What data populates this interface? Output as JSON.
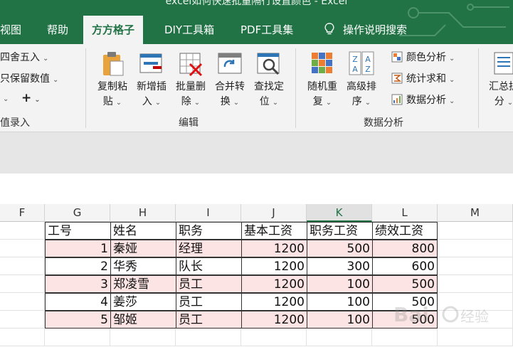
{
  "window": {
    "title_partial": "excel如何快速批量隔行设置颜色 - Excel"
  },
  "tabs": [
    {
      "label": "视图"
    },
    {
      "label": "帮助"
    },
    {
      "label": "方方格子",
      "active": true
    },
    {
      "label": "DIY工具箱"
    },
    {
      "label": "PDF工具集"
    },
    {
      "label": "操作说明搜索"
    }
  ],
  "ribbon": {
    "left_group": {
      "round": "四舍五入",
      "keep_values": "只保留数值",
      "plus": "+",
      "group_label": "值录入"
    },
    "edit_group": {
      "buttons": [
        {
          "line1": "复制粘",
          "line2": "贴"
        },
        {
          "line1": "新增插",
          "line2": "入"
        },
        {
          "line1": "批量删",
          "line2": "除"
        },
        {
          "line1": "合并转",
          "line2": "换"
        },
        {
          "line1": "查找定",
          "line2": "位"
        }
      ],
      "group_label": "编辑"
    },
    "analysis_group": {
      "buttons": [
        {
          "line1": "随机重",
          "line2": "复"
        },
        {
          "line1": "高级排",
          "line2": "序"
        }
      ],
      "small_items": [
        "颜色分析",
        "统计求和",
        "数据分析"
      ],
      "group_label": "数据分析"
    },
    "summary_group": {
      "line1": "汇总拆",
      "line2": "分"
    },
    "sort_glyph": {
      "top": "Z",
      "mid": "A",
      "right_top": "A",
      "right_bottom": "Z"
    }
  },
  "grid": {
    "columns": [
      "F",
      "G",
      "H",
      "I",
      "J",
      "K",
      "L",
      "M"
    ],
    "selected_column": "K",
    "header": [
      "工号",
      "姓名",
      "职务",
      "基本工资",
      "职务工资",
      "绩效工资"
    ],
    "rows": [
      [
        "1",
        "秦娅",
        "经理",
        "1200",
        "500",
        "800"
      ],
      [
        "2",
        "华秀",
        "队长",
        "1200",
        "300",
        "600"
      ],
      [
        "3",
        "郑凌雪",
        "员工",
        "1200",
        "100",
        "500"
      ],
      [
        "4",
        "姜莎",
        "员工",
        "1200",
        "100",
        "500"
      ],
      [
        "5",
        "邹姬",
        "员工",
        "1200",
        "100",
        "500"
      ]
    ],
    "highlight_color": "#fce4e4"
  },
  "watermark": {
    "brand": "Bai",
    "suffix": "经验"
  },
  "colors": {
    "excel_green": "#217346",
    "ribbon_bg": "#f3f3f3"
  }
}
